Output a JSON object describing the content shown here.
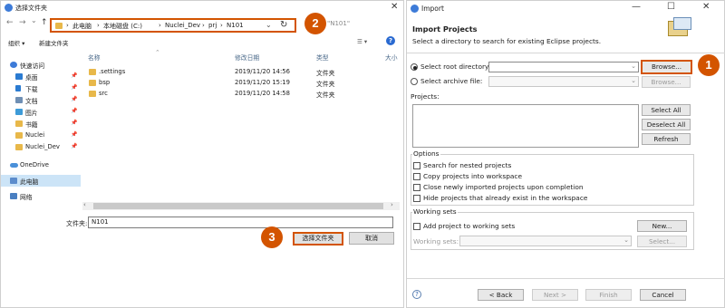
{
  "picker": {
    "title": "选择文件夹",
    "close": "✕",
    "nav": {
      "back": "←",
      "forward": "→",
      "dropdown": "⌄",
      "up": "↑"
    },
    "address": [
      "此电脑",
      "本地磁盘 (C:)",
      "Nuclei_Dev",
      "prj",
      "N101"
    ],
    "address_sep": "›",
    "address_dd": "⌄",
    "refresh": "↻",
    "search_text": "\"N101\"",
    "cmd": {
      "organize": "组织 ▾",
      "new_folder": "新建文件夹",
      "view": "☰ ▾",
      "help": "?"
    },
    "sidebar": [
      {
        "label": "快速访问",
        "color": "#3d7bd8",
        "pin": "",
        "top": true
      },
      {
        "label": "桌面",
        "color": "#2b7bd1",
        "pin": "📌"
      },
      {
        "label": "下载",
        "color": "#2b7bd1",
        "pin": "📌"
      },
      {
        "label": "文档",
        "color": "#6f8fb4",
        "pin": "📌"
      },
      {
        "label": "图片",
        "color": "#3d9bd8",
        "pin": "📌"
      },
      {
        "label": "书籍",
        "color": "#e8b84a",
        "pin": "📌"
      },
      {
        "label": "Nuclei",
        "color": "#e8b84a",
        "pin": "📌"
      },
      {
        "label": "Nuclei_Dev",
        "color": "#e8b84a",
        "pin": "📌"
      },
      {
        "label": "OneDrive",
        "color": "#4a90d9",
        "pin": ""
      },
      {
        "label": "此电脑",
        "color": "#5c8ccc",
        "pin": ""
      },
      {
        "label": "网络",
        "color": "#4a7fc1",
        "pin": ""
      }
    ],
    "columns": {
      "name": "名称",
      "date": "修改日期",
      "type": "类型",
      "size": "大小"
    },
    "files": [
      {
        "name": ".settings",
        "date": "2019/11/20 14:56",
        "type": "文件夹"
      },
      {
        "name": "bsp",
        "date": "2019/11/20 15:19",
        "type": "文件夹"
      },
      {
        "name": "src",
        "date": "2019/11/20 14:58",
        "type": "文件夹"
      }
    ],
    "scroll": {
      "left": "‹",
      "right": "›"
    },
    "folder_label": "文件夹:",
    "folder_value": "N101",
    "select_button": "选择文件夹",
    "cancel_button": "取消"
  },
  "import": {
    "title": "Import",
    "window": {
      "min": "—",
      "max": "☐",
      "close": "✕"
    },
    "header_title": "Import Projects",
    "header_sub": "Select a directory to search for existing Eclipse projects.",
    "root_radio": "Select root directory:",
    "archive_radio": "Select archive file:",
    "root_value": "",
    "browse": "Browse...",
    "browse2": "Browse...",
    "projects_label": "Projects:",
    "select_all": "Select All",
    "deselect_all": "Deselect All",
    "refresh": "Refresh",
    "options_label": "Options",
    "options": [
      "Search for nested projects",
      "Copy projects into workspace",
      "Close newly imported projects upon completion",
      "Hide projects that already exist in the workspace"
    ],
    "working_sets_label": "Working sets",
    "add_ws": "Add project to working sets",
    "new_btn": "New...",
    "ws_label": "Working sets:",
    "select_btn": "Select...",
    "help": "?",
    "back": "< Back",
    "next": "Next >",
    "finish": "Finish",
    "cancel": "Cancel"
  },
  "badges": [
    "1",
    "2",
    "3"
  ],
  "colors": {
    "callout": "#d35400",
    "folder": "#e8b84a",
    "selection": "#cce4f7"
  }
}
